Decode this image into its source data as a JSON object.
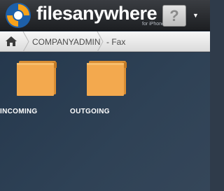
{
  "header": {
    "brand": "filesanywhere",
    "tagline": "for iPhone",
    "avatar_glyph": "?",
    "menu_glyph": "▼"
  },
  "breadcrumb": {
    "items": [
      {
        "label": "COMPANYADMIN"
      },
      {
        "label": "- Fax"
      }
    ]
  },
  "folders": [
    {
      "label": "INCOMING"
    },
    {
      "label": "OUTGOING"
    }
  ],
  "colors": {
    "folder": "#f3a94e",
    "header": "#2a2c30",
    "background": "#2f4256"
  }
}
